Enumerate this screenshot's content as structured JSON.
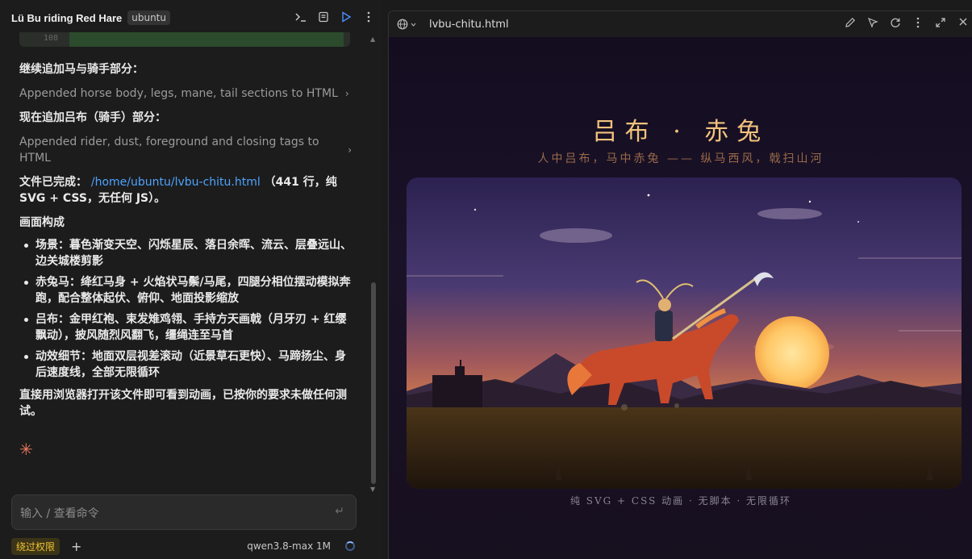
{
  "left_panel": {
    "title": "Lü Bu riding Red Hare",
    "env_chip": "ubuntu",
    "code_line_number": "108",
    "messages": {
      "p1": "继续追加马与骑手部分：",
      "tool1": "Appended horse body, legs, mane, tail sections to HTML",
      "p2": "现在追加吕布（骑手）部分：",
      "tool2": "Appended rider, dust, foreground and closing tags to HTML",
      "done_prefix": "文件已完成：",
      "done_path": "/home/ubuntu/lvbu-chitu.html",
      "done_suffix": "（441 行，纯 SVG + CSS，无任何 JS）。",
      "section_title": "画面构成",
      "bullets": [
        "场景：暮色渐变天空、闪烁星辰、落日余晖、流云、层叠远山、边关城楼剪影",
        "赤兔马：绛红马身 + 火焰状马鬃/马尾，四腿分相位摆动模拟奔跑，配合整体起伏、俯仰、地面投影缩放",
        "吕布：金甲红袍、束发雉鸡翎、手持方天画戟（月牙刃 + 红缨飘动），披风随烈风翻飞，缰绳连至马首",
        "动效细节：地面双层视差滚动（近景草石更快）、马蹄扬尘、身后速度线，全部无限循环"
      ],
      "closing": "直接用浏览器打开该文件即可看到动画，已按你的要求未做任何测试。"
    },
    "input": {
      "placeholder": "输入 / 查看命令"
    },
    "bottom": {
      "bypass_label": "绕过权限",
      "plus_label": "+",
      "model_label": "qwen3.8-max 1M"
    },
    "icons": [
      "terminal-icon",
      "file-icon",
      "play-icon",
      "more-vertical-icon",
      "sparkle-icon",
      "enter-icon"
    ]
  },
  "right_panel": {
    "filename": "lvbu-chitu.html",
    "page_title": "吕布 · 赤兔",
    "page_subtitle": "人中吕布，马中赤兔 —— 纵马西风，戟扫山河",
    "caption": "纯 SVG + CSS 动画 · 无脚本 · 无限循环",
    "icons": [
      "globe-icon",
      "pencil-icon",
      "pointer-icon",
      "refresh-icon",
      "more-vertical-icon",
      "expand-icon",
      "close-icon"
    ]
  },
  "colors": {
    "accent_blue": "#4a90ff",
    "link": "#4fa3ff",
    "title_gold": "#f1c27d",
    "subtitle": "#9a6a4a",
    "bypass_yellow": "#f1c232",
    "sun": "#ffd27a"
  }
}
